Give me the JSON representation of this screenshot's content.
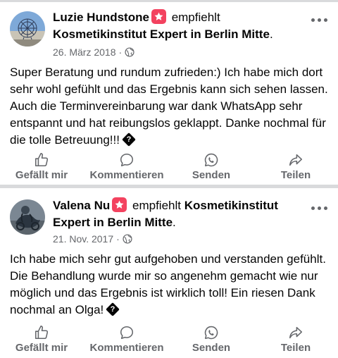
{
  "posts": [
    {
      "author": "Luzie Hundstone",
      "verb": "empfiehlt",
      "page": "Kosmetikinstitut Expert in Berlin Mitte",
      "page_suffix": ".",
      "date": "26. März 2018",
      "dot": "·",
      "text": "Super Beratung und rundum zufrieden:) Ich habe mich dort sehr wohl gefühlt und das Ergebnis kann sich sehen lassen. Auch die Terminvereinbarung war dank WhatsApp sehr entspannt und hat reibungslos geklappt. Danke nochmal für die tolle Betreuung!!!",
      "emoji_glyph": "?"
    },
    {
      "author": "Valena Nu",
      "verb": "empfiehlt",
      "page": "Kosmetikinstitut Expert in Berlin Mitte",
      "page_suffix": ".",
      "date": "21. Nov. 2017",
      "dot": "·",
      "text": "Ich habe mich sehr gut aufgehoben und verstanden gefühlt. Die Behandlung wurde mir so angenehm gemacht wie nur möglich und das Ergebnis ist wirklich toll! Ein riesen Dank nochmal an Olga!",
      "emoji_glyph": "?"
    }
  ],
  "actions": {
    "like": "Gefällt mir",
    "comment": "Kommentieren",
    "send": "Senden",
    "share": "Teilen"
  },
  "colors": {
    "recommend_badge": "#f3425f",
    "secondary_text": "#65676b",
    "separator": "#d9dadc"
  },
  "icons": {
    "recommend": "star-badge-icon",
    "privacy": "globe-icon",
    "like": "thumbs-up-icon",
    "comment": "speech-bubble-icon",
    "send": "whatsapp-icon",
    "share": "share-arrow-icon",
    "more": "more-options-icon"
  }
}
